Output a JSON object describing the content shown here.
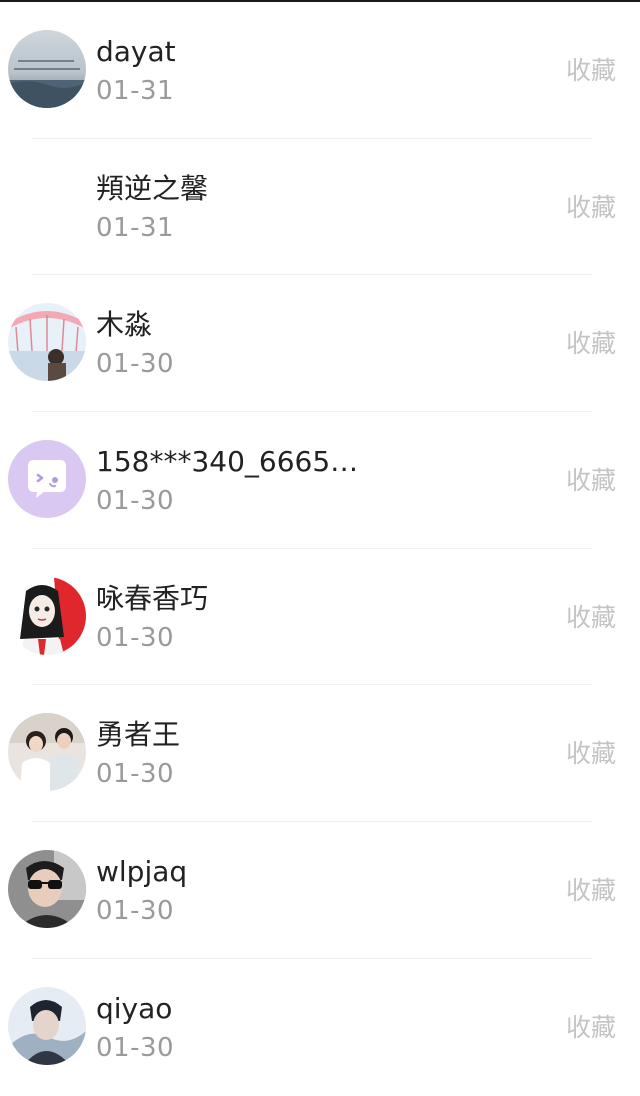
{
  "items": [
    {
      "name": "dayat",
      "date": "01-31",
      "action": "收藏",
      "avatar": "sea-scenery-avatar"
    },
    {
      "name": "頖逆之馨",
      "date": "01-31",
      "action": "收藏",
      "avatar": "none"
    },
    {
      "name": "木淼",
      "date": "01-30",
      "action": "收藏",
      "avatar": "carousel-photo-avatar"
    },
    {
      "name": "158***340_6665…",
      "date": "01-30",
      "action": "收藏",
      "avatar": "default-chat-avatar"
    },
    {
      "name": "咏春香巧",
      "date": "01-30",
      "action": "收藏",
      "avatar": "anime-girl-avatar"
    },
    {
      "name": "勇者王",
      "date": "01-30",
      "action": "收藏",
      "avatar": "couple-photo-avatar"
    },
    {
      "name": "wlpjaq",
      "date": "01-30",
      "action": "收藏",
      "avatar": "sunglasses-man-avatar"
    },
    {
      "name": "qiyao",
      "date": "01-30",
      "action": "收藏",
      "avatar": "dark-portrait-avatar"
    }
  ],
  "colors": {
    "name_text": "#222222",
    "date_text": "#9a9a9a",
    "action_text": "#c4c4c4",
    "default_avatar_bg": "#d9c8f2"
  }
}
